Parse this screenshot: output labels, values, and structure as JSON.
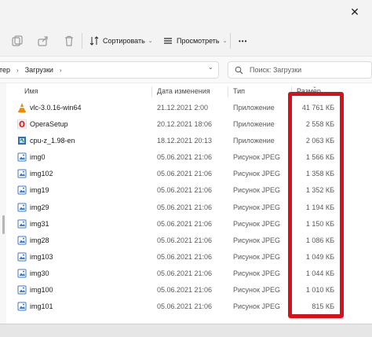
{
  "window": {
    "close_glyph": "✕"
  },
  "toolbar": {
    "sort_label": "Сортировать",
    "view_label": "Просмотреть",
    "more_label": "•••"
  },
  "address": {
    "crumb_parent": "тер",
    "crumb_current": "Загрузки"
  },
  "search": {
    "placeholder": "Поиск: Загрузки"
  },
  "columns": {
    "name": "Имя",
    "date": "Дата изменения",
    "type": "Тип",
    "size": "Размер"
  },
  "files": [
    {
      "name": "vlc-3.0.16-win64",
      "date": "21.12.2021 2:00",
      "type": "Приложение",
      "size": "41 761 КБ",
      "icon": "vlc-icon"
    },
    {
      "name": "OperaSetup",
      "date": "20.12.2021 18:06",
      "type": "Приложение",
      "size": "2 558 КБ",
      "icon": "opera-icon"
    },
    {
      "name": "cpu-z_1.98-en",
      "date": "18.12.2021 20:13",
      "type": "Приложение",
      "size": "2 063 КБ",
      "icon": "cpuz-icon"
    },
    {
      "name": "img0",
      "date": "05.06.2021 21:06",
      "type": "Рисунок JPEG",
      "size": "1 566 КБ",
      "icon": "image-file-icon"
    },
    {
      "name": "img102",
      "date": "05.06.2021 21:06",
      "type": "Рисунок JPEG",
      "size": "1 358 КБ",
      "icon": "image-file-icon"
    },
    {
      "name": "img19",
      "date": "05.06.2021 21:06",
      "type": "Рисунок JPEG",
      "size": "1 352 КБ",
      "icon": "image-file-icon"
    },
    {
      "name": "img29",
      "date": "05.06.2021 21:06",
      "type": "Рисунок JPEG",
      "size": "1 194 КБ",
      "icon": "image-file-icon"
    },
    {
      "name": "img31",
      "date": "05.06.2021 21:06",
      "type": "Рисунок JPEG",
      "size": "1 150 КБ",
      "icon": "image-file-icon"
    },
    {
      "name": "img28",
      "date": "05.06.2021 21:06",
      "type": "Рисунок JPEG",
      "size": "1 086 КБ",
      "icon": "image-file-icon"
    },
    {
      "name": "img103",
      "date": "05.06.2021 21:06",
      "type": "Рисунок JPEG",
      "size": "1 049 КБ",
      "icon": "image-file-icon"
    },
    {
      "name": "img30",
      "date": "05.06.2021 21:06",
      "type": "Рисунок JPEG",
      "size": "1 044 КБ",
      "icon": "image-file-icon"
    },
    {
      "name": "img100",
      "date": "05.06.2021 21:06",
      "type": "Рисунок JPEG",
      "size": "1 010 КБ",
      "icon": "image-file-icon"
    },
    {
      "name": "img101",
      "date": "05.06.2021 21:06",
      "type": "Рисунок JPEG",
      "size": "815 КБ",
      "icon": "image-file-icon"
    }
  ],
  "colors": {
    "highlight": "#d7111a",
    "vlc": "#f08a00",
    "opera": "#e0252c",
    "image_icon": "#3a78c8"
  }
}
